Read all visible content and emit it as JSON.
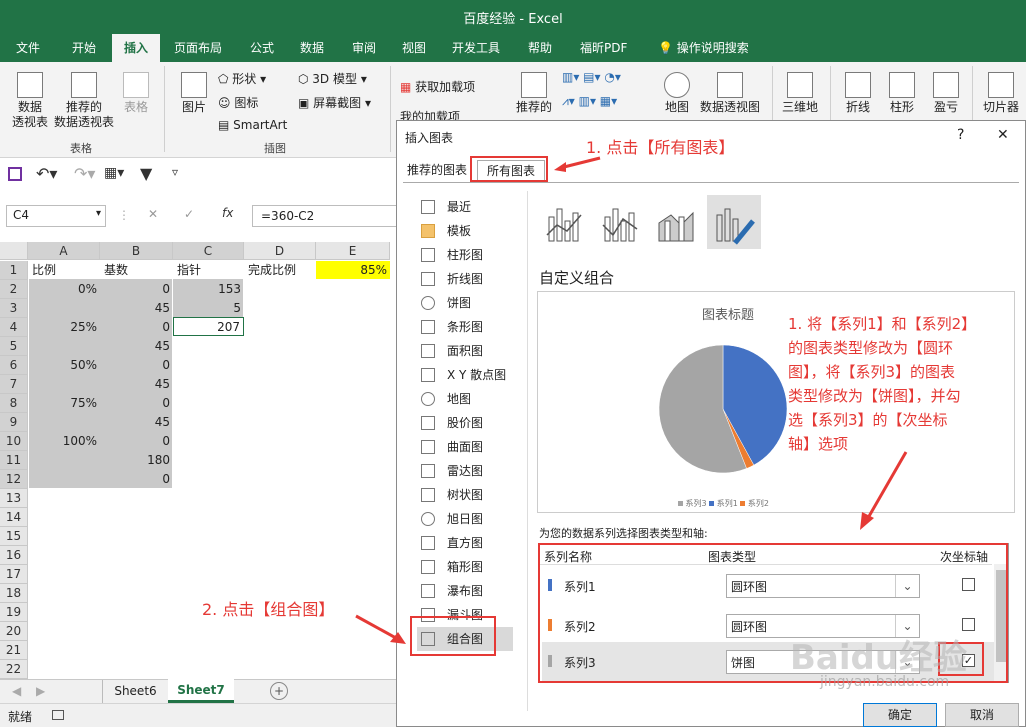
{
  "app": {
    "title": "百度经验 - Excel"
  },
  "menu": [
    "文件",
    "开始",
    "插入",
    "页面布局",
    "公式",
    "数据",
    "审阅",
    "视图",
    "开发工具",
    "帮助",
    "福昕PDF",
    "操作说明搜索"
  ],
  "ribbon": {
    "pivot": "数据\n透视表",
    "rec_pivot": "推荐的\n数据透视表",
    "table": "表格",
    "group_tables": "表格",
    "picture": "图片",
    "shapes": "形状",
    "icons": "图标",
    "smartart": "SmartArt",
    "model3d": "3D 模型",
    "screenshot": "屏幕截图",
    "group_illus": "插图",
    "get_addins": "获取加载项",
    "my_addins": "我的加载项",
    "rec_charts": "推荐的",
    "map": "地图",
    "pivot_chart": "数据透视图",
    "map3d": "三维地",
    "line": "折线",
    "column": "柱形",
    "winloss": "盈亏",
    "slicer": "切片器"
  },
  "formula": {
    "namebox": "C4",
    "formula": "=360-C2",
    "fx": "fx"
  },
  "columns": [
    "A",
    "B",
    "C",
    "D",
    "E"
  ],
  "rows": [
    "1",
    "2",
    "3",
    "4",
    "5",
    "6",
    "7",
    "8",
    "9",
    "10",
    "11",
    "12",
    "13",
    "14",
    "15",
    "16",
    "17",
    "18",
    "19",
    "20",
    "21",
    "22"
  ],
  "cells": {
    "A1": "比例",
    "B1": "基数",
    "C1": "指针",
    "D1": "完成比例",
    "E1": "85%",
    "A2": "0%",
    "B2": "0",
    "C2": "153",
    "B3": "45",
    "C3": "5",
    "A4": "25%",
    "B4": "0",
    "C4": "207",
    "B5": "45",
    "A6": "50%",
    "B6": "0",
    "B7": "45",
    "A8": "75%",
    "B8": "0",
    "B9": "45",
    "A10": "100%",
    "B10": "0",
    "B11": "180",
    "B12": "0"
  },
  "sheets": [
    "Sheet6",
    "Sheet7"
  ],
  "status": "就绪",
  "dialog": {
    "title": "插入图表",
    "help": "?",
    "close": "✕",
    "tabs": [
      "推荐的图表",
      "所有图表"
    ],
    "sidebar": [
      "最近",
      "模板",
      "柱形图",
      "折线图",
      "饼图",
      "条形图",
      "面积图",
      "X Y 散点图",
      "地图",
      "股价图",
      "曲面图",
      "雷达图",
      "树状图",
      "旭日图",
      "直方图",
      "箱形图",
      "瀑布图",
      "漏斗图",
      "组合图"
    ],
    "section_title": "自定义组合",
    "preview_title": "图表标题",
    "legend": [
      "系列3",
      "系列1",
      "系列2"
    ],
    "assign_label": "为您的数据系列选择图表类型和轴:",
    "col_series": "系列名称",
    "col_type": "图表类型",
    "col_axis": "次坐标轴",
    "series": [
      {
        "name": "系列1",
        "type": "圆环图",
        "secondary": false,
        "color": "#4472c4"
      },
      {
        "name": "系列2",
        "type": "圆环图",
        "secondary": false,
        "color": "#ed7d31"
      },
      {
        "name": "系列3",
        "type": "饼图",
        "secondary": true,
        "color": "#a5a5a5"
      }
    ],
    "ok": "确定",
    "cancel": "取消"
  },
  "annotations": {
    "a1": "1. 点击【所有图表】",
    "a2": "2. 点击【组合图】",
    "a3": "1. 将【系列1】和【系列2】\n的图表类型修改为【圆环\n图】，将【系列3】的图表\n类型修改为【饼图】，并勾\n选【系列3】的【次坐标\n轴】选项"
  },
  "watermark": {
    "text": "Baidu经验",
    "url": "jingyan.baidu.com"
  },
  "pie": {
    "slices": [
      {
        "name": "系列3",
        "fraction": 0.56,
        "color": "#a5a5a5"
      },
      {
        "name": "系列1",
        "fraction": 0.42,
        "color": "#4472c4"
      },
      {
        "name": "系列2",
        "fraction": 0.02,
        "color": "#ed7d31"
      }
    ]
  }
}
